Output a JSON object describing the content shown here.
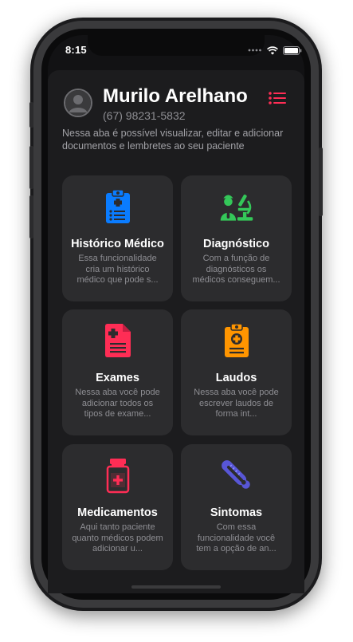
{
  "status_bar": {
    "time": "8:15"
  },
  "header": {
    "patient_name": "Murilo Arelhano",
    "patient_phone": "(67) 98231-5832",
    "description": "Nessa aba é possível visualizar, editar e adicionar documentos e lembretes ao seu paciente"
  },
  "icons": {
    "avatar": "person-circle-icon",
    "menu": "list-menu-icon",
    "historico": "clipboard-list-icon",
    "diagnostico": "doctor-microscope-icon",
    "exames": "medical-document-icon",
    "laudos": "clipboard-plus-icon",
    "medicamentos": "medicine-bottle-icon",
    "sintomas": "thermometer-icon"
  },
  "colors": {
    "accent_red": "#ff2d55",
    "blue": "#0a7cff",
    "green": "#34c759",
    "orange": "#ff9500",
    "indigo": "#5856d6"
  },
  "cards": [
    {
      "title": "Histórico Médico",
      "desc": "Essa funcionalidade cria um histórico médico que pode s..."
    },
    {
      "title": "Diagnóstico",
      "desc": "Com a função de diagnósticos os médicos conseguem..."
    },
    {
      "title": "Exames",
      "desc": "Nessa aba você pode adicionar todos os tipos de exame..."
    },
    {
      "title": "Laudos",
      "desc": "Nessa aba você pode escrever laudos de forma int..."
    },
    {
      "title": "Medicamentos",
      "desc": "Aqui tanto paciente quanto médicos podem adicionar u..."
    },
    {
      "title": "Sintomas",
      "desc": "Com essa funcionalidade você tem a opção de an..."
    }
  ]
}
